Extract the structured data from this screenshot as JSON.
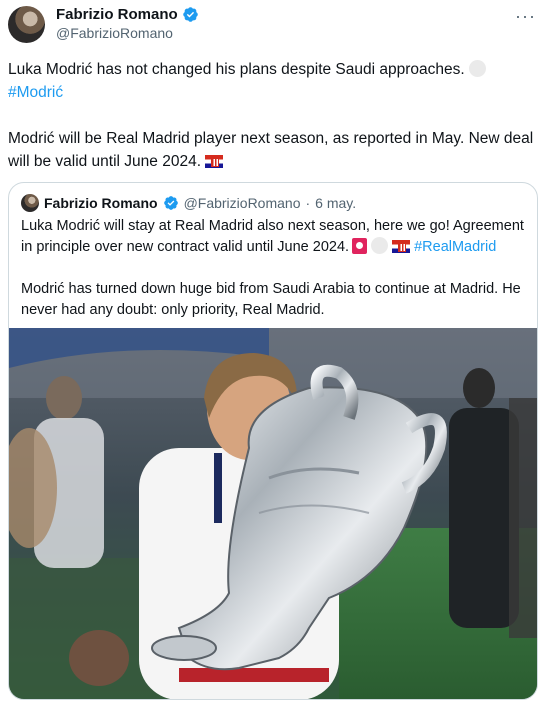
{
  "author": {
    "name": "Fabrizio Romano",
    "handle": "@FabrizioRomano"
  },
  "tweet": {
    "line1": "Luka Modrić has not changed his plans despite Saudi approaches.",
    "hashtag": "#Modrić",
    "line2": "Modrić will be Real Madrid player next season, as reported in May. New deal will be valid until June 2024."
  },
  "quoted": {
    "name": "Fabrizio Romano",
    "handle": "@FabrizioRomano",
    "separator": "·",
    "date": "6 may.",
    "line1": "Luka Modrić will stay at Real Madrid also next season, here we go! Agreement in principle over new contract valid until June 2024.",
    "hashtag": "#RealMadrid",
    "line2": "Modrić has turned down huge bid from Saudi Arabia to continue at Madrid. He never had any doubt: only priority, Real Madrid."
  },
  "icons": {
    "verified": "verified-badge-icon",
    "more": "more-options-icon",
    "flag": "croatia-flag-emoji",
    "emblem": "club-crest-emoji"
  },
  "colors": {
    "accent": "#1d9bf0",
    "text": "#0f1419",
    "secondary": "#536471",
    "border": "#cfd9de"
  }
}
